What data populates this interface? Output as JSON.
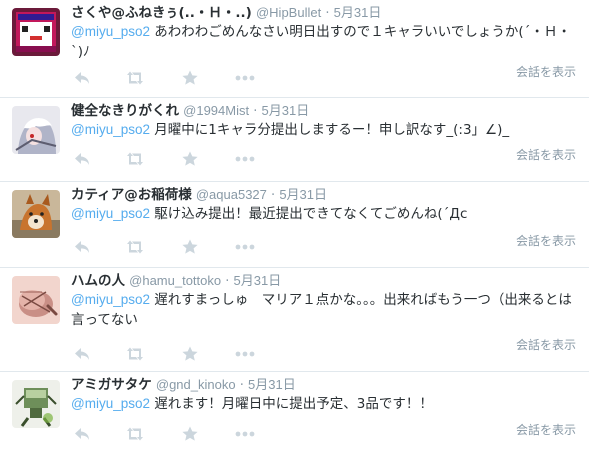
{
  "tweets": [
    {
      "fullname": "さくや@ふねきぅ(..・Ｈ・..)",
      "username": "@HipBullet",
      "dot": "·",
      "time": "5月31日",
      "mention": "@miyu_pso2",
      "text": " あわわわごめんなさい明日出すので１キャラいいでしょうか(´・Ｈ・`)ﾉ",
      "conversation": "会話を表示"
    },
    {
      "fullname": "健全なきりがくれ",
      "username": "@1994Mist",
      "dot": "·",
      "time": "5月31日",
      "mention": "@miyu_pso2",
      "text": " 月曜中に1キャラ分提出しまするー！申し訳なす_(:3」∠)_",
      "conversation": "会話を表示"
    },
    {
      "fullname": "カティア@お稲荷様",
      "username": "@aqua5327",
      "dot": "·",
      "time": "5月31日",
      "mention": "@miyu_pso2",
      "text": " 駆け込み提出！最近提出できてなくてごめんね(´Дc",
      "conversation": "会話を表示"
    },
    {
      "fullname": "ハムの人",
      "username": "@hamu_tottoko",
      "dot": "·",
      "time": "5月31日",
      "mention": "@miyu_pso2",
      "text": " 遅れすまっしゅ　マリア１点かな。。。出来ればもう一つ（出来るとは言ってない",
      "conversation": "会話を表示"
    },
    {
      "fullname": "アミガサタケ",
      "username": "@gnd_kinoko",
      "dot": "·",
      "time": "5月31日",
      "mention": "@miyu_pso2",
      "text": " 遅れます！月曜日中に提出予定、3品です！！",
      "conversation": "会話を表示"
    }
  ],
  "icons": {
    "reply": "reply-icon",
    "retweet": "retweet-icon",
    "favorite": "star-icon",
    "more": "more-icon"
  },
  "colors": {
    "link": "#55acee",
    "muted": "#8899a6",
    "action_icon": "#ccd6dd",
    "divider": "#e1e8ed"
  }
}
